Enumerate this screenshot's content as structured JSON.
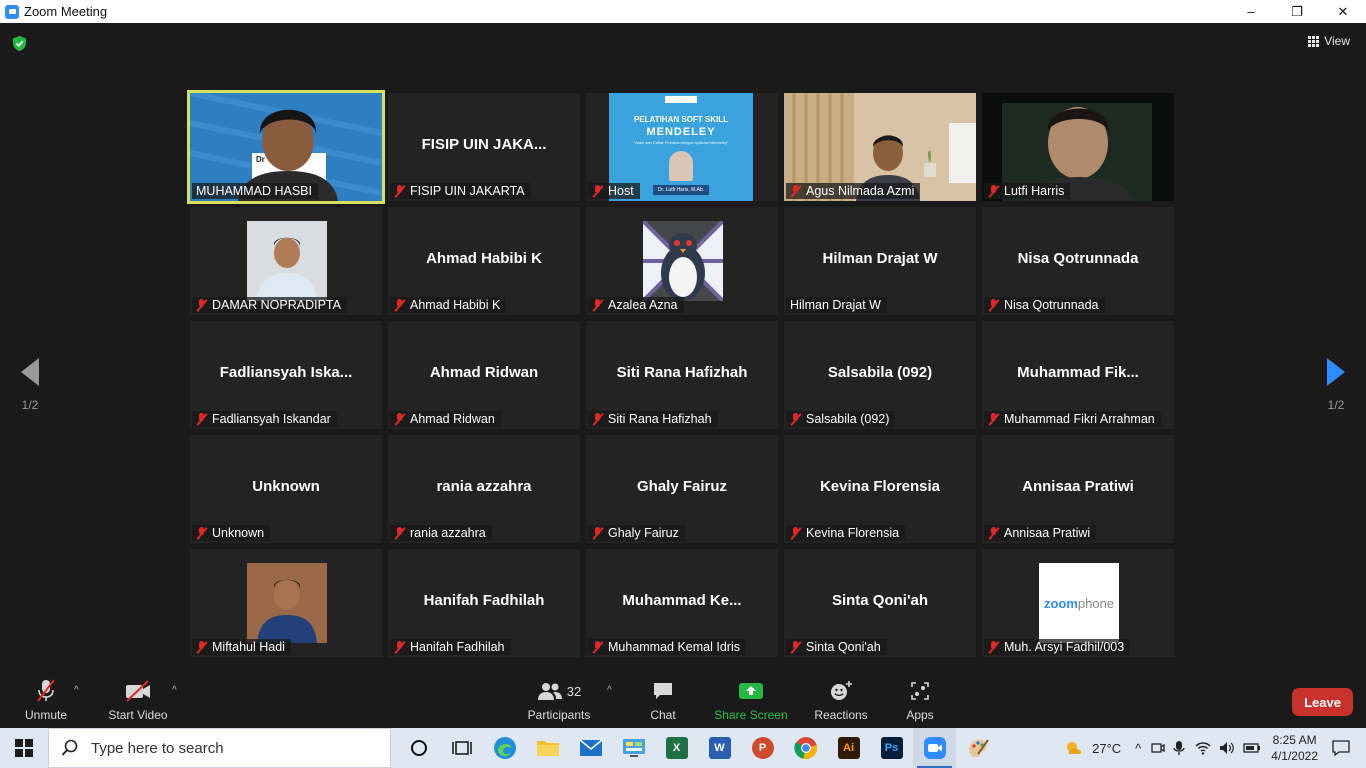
{
  "window": {
    "title": "Zoom Meeting",
    "minimize": "–",
    "restore": "❐",
    "close": "✕"
  },
  "view_label": "View",
  "pager": {
    "left": "1/2",
    "right": "1/2"
  },
  "tiles": [
    {
      "name": "MUHAMMAD HASBI",
      "label": "MUHAMMAD HASBI",
      "type": "photo-man-blue",
      "muted": false,
      "active": true
    },
    {
      "name": "FISIP UIN JAKA...",
      "label": "FISIP UIN JAKARTA",
      "type": "name",
      "muted": true
    },
    {
      "name": "Host",
      "label": "Host",
      "type": "slide",
      "muted": true
    },
    {
      "name": "Agus Nilmada Azmi",
      "label": "Agus Nilmada Azmi",
      "type": "photo-room",
      "muted": true
    },
    {
      "name": "Lutfi Harris",
      "label": "Lutfi Harris",
      "type": "photo-dark",
      "muted": true
    },
    {
      "name": "DAMAR NOPRADIPTA",
      "label": "DAMAR NOPRADIPTA",
      "type": "avatar-man",
      "muted": true
    },
    {
      "name": "Ahmad Habibi K",
      "label": "Ahmad Habibi K",
      "type": "name",
      "muted": true
    },
    {
      "name": "Azalea Azna",
      "label": "Azalea Azna",
      "type": "avatar-penguin",
      "muted": true
    },
    {
      "name": "Hilman Drajat W",
      "label": "Hilman Drajat W",
      "type": "name",
      "muted": false
    },
    {
      "name": "Nisa Qotrunnada",
      "label": "Nisa Qotrunnada",
      "type": "name",
      "muted": true
    },
    {
      "name": "Fadliansyah  Iska...",
      "label": "Fadliansyah Iskandar",
      "type": "name",
      "muted": true
    },
    {
      "name": "Ahmad Ridwan",
      "label": "Ahmad Ridwan",
      "type": "name",
      "muted": true
    },
    {
      "name": "Siti Rana Hafizhah",
      "label": "Siti Rana Hafizhah",
      "type": "name",
      "muted": true
    },
    {
      "name": "Salsabila (092)",
      "label": "Salsabila (092)",
      "type": "name",
      "muted": true
    },
    {
      "name": "Muhammad  Fik...",
      "label": "Muhammad Fikri Arrahman",
      "type": "name",
      "muted": true
    },
    {
      "name": "Unknown",
      "label": "Unknown",
      "type": "name",
      "muted": true
    },
    {
      "name": "rania azzahra",
      "label": "rania azzahra",
      "type": "name",
      "muted": true
    },
    {
      "name": "Ghaly Fairuz",
      "label": "Ghaly Fairuz",
      "type": "name",
      "muted": true
    },
    {
      "name": "Kevina Florensia",
      "label": "Kevina Florensia",
      "type": "name",
      "muted": true
    },
    {
      "name": "Annisaa Pratiwi",
      "label": "Annisaa Pratiwi",
      "type": "name",
      "muted": true
    },
    {
      "name": "Miftahul Hadi",
      "label": "Miftahul Hadi",
      "type": "avatar-youth",
      "muted": true
    },
    {
      "name": "Hanifah Fadhilah",
      "label": "Hanifah Fadhilah",
      "type": "name",
      "muted": true
    },
    {
      "name": "Muhammad  Ke...",
      "label": "Muhammad Kemal Idris",
      "type": "name",
      "muted": true
    },
    {
      "name": "Sinta Qoni'ah",
      "label": "Sinta Qoni'ah",
      "type": "name",
      "muted": true
    },
    {
      "name": "Muh. Arsyi Fadhil/003",
      "label": "Muh. Arsyi Fadhil/003",
      "type": "avatar-zoomphone",
      "muted": true
    }
  ],
  "slide": {
    "title_line1": "PELATIHAN SOFT SKILL",
    "title_line2": "MENDELEY",
    "subtitle": "\"Atasi dan Daftar Pustaka dengan Aplikasi Mendeley\"",
    "presenter": "Dr. Lutfi Haris, M.Ab."
  },
  "hasbi_sign": "Dr",
  "zoomphone": {
    "zoom": "zoom",
    "phone": "phone"
  },
  "toolbar": {
    "unmute": "Unmute",
    "start_video": "Start Video",
    "participants": "Participants",
    "participants_count": "32",
    "chat": "Chat",
    "share_screen": "Share Screen",
    "reactions": "Reactions",
    "apps": "Apps",
    "leave": "Leave"
  },
  "taskbar": {
    "search_placeholder": "Type here to search",
    "apps": [
      "cortana-icon",
      "task-view-icon",
      "edge-icon",
      "file-explorer-icon",
      "mail-icon",
      "control-panel-icon",
      "excel-icon",
      "word-icon",
      "powerpoint-icon",
      "chrome-icon",
      "illustrator-icon",
      "photoshop-icon",
      "zoom-icon",
      "paint-icon"
    ],
    "excel": "X",
    "word": "W",
    "powerpoint": "P",
    "illustrator": "Ai",
    "photoshop": "Ps",
    "weather": "27°C",
    "time": "8:25 AM",
    "date": "4/1/2022"
  },
  "colors": {
    "accent": "#2d8cff",
    "leave": "#c8312c",
    "active_speaker": "#d7e05c",
    "muted": "#e02828",
    "share": "#23b844"
  }
}
